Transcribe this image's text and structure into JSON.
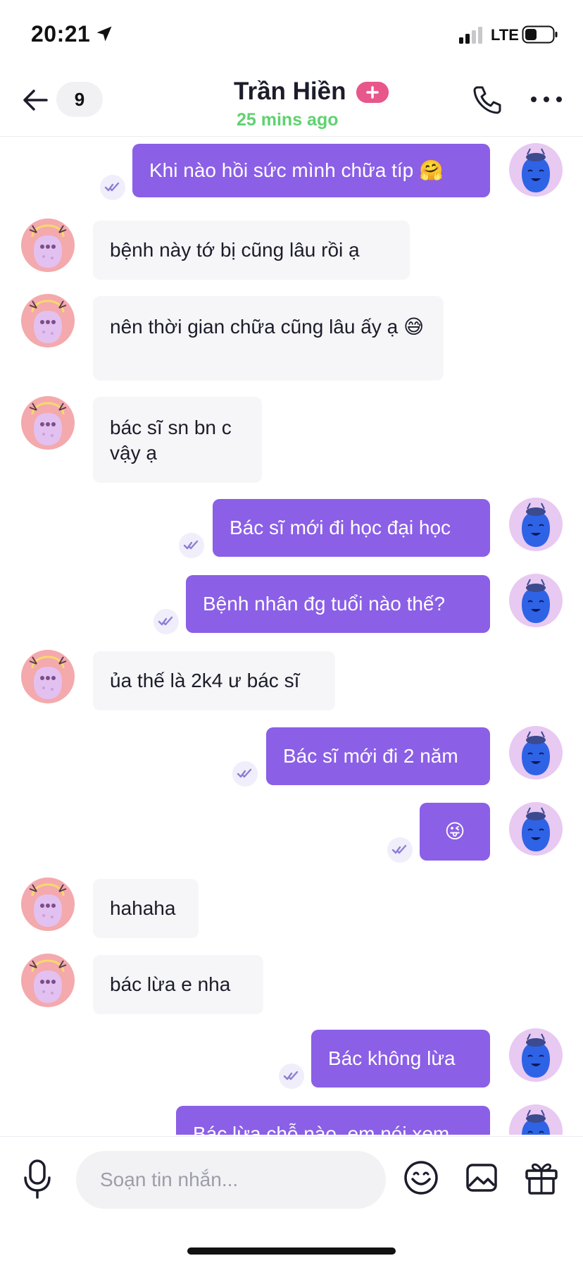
{
  "status_bar": {
    "time": "20:21",
    "network": "LTE"
  },
  "header": {
    "unread_count": "9",
    "contact_name": "Trần Hiền",
    "last_seen": "25 mins ago"
  },
  "messages": [
    {
      "direction": "out",
      "text": "Khi nào hồi sức mình chữa típ 🤗"
    },
    {
      "direction": "in",
      "text": "bệnh này tớ bị cũng lâu rồi ạ"
    },
    {
      "direction": "in",
      "text": "nên thời gian chữa cũng lâu ấy ạ 😅"
    },
    {
      "direction": "in",
      "text": "bác sĩ sn bn c vậy ạ"
    },
    {
      "direction": "out",
      "text": "Bác sĩ mới đi học đại học"
    },
    {
      "direction": "out",
      "text": "Bệnh nhân đg tuổi nào thế?"
    },
    {
      "direction": "in",
      "text": "ủa thế là 2k4 ư bác sĩ"
    },
    {
      "direction": "out",
      "text": "Bác sĩ mới đi 2 năm"
    },
    {
      "direction": "out",
      "text": "😜"
    },
    {
      "direction": "in",
      "text": "hahaha"
    },
    {
      "direction": "in",
      "text": "bác lừa e nha"
    },
    {
      "direction": "out",
      "text": "Bác không lừa"
    },
    {
      "direction": "out",
      "text": "Bác lừa chỗ nào, em nói xem"
    }
  ],
  "composer": {
    "placeholder": "Soạn tin nhắn..."
  },
  "colors": {
    "outgoing_bubble": "#8b5fe6",
    "incoming_bubble": "#f6f6f8",
    "online_status": "#5fd26f",
    "accent_badge": "#e8578b"
  }
}
